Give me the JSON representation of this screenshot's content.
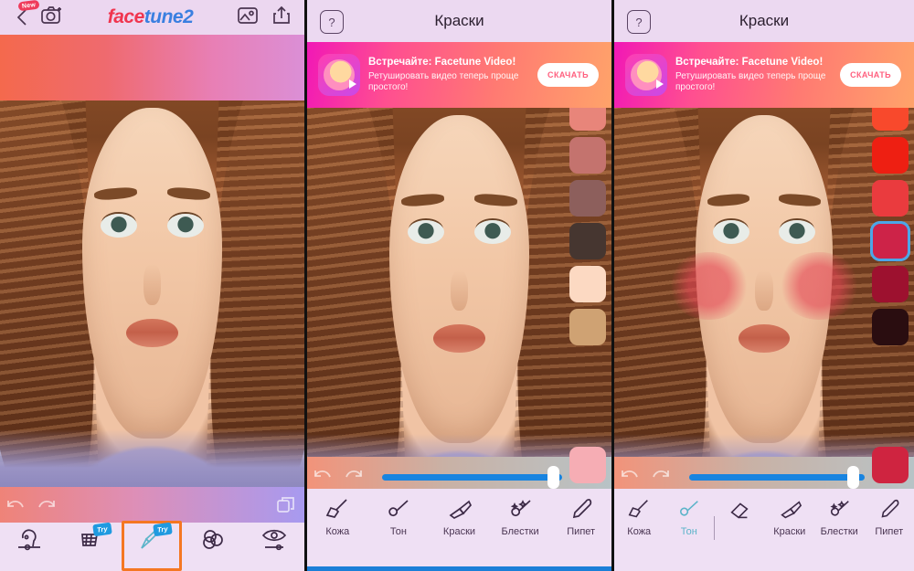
{
  "app": {
    "logo_face": "face",
    "logo_tune": "tune2",
    "new_badge": "New"
  },
  "panel1": {
    "icons": {
      "back": "back-chevron-icon",
      "camera": "camera-icon",
      "gallery": "gallery-icon",
      "share": "share-icon",
      "undo": "undo-icon",
      "redo": "redo-icon",
      "compare": "compare-icon"
    },
    "tools": [
      {
        "label": "",
        "icon": "face-reshape-icon",
        "badge": "",
        "active": false
      },
      {
        "label": "",
        "icon": "patch-grid-icon",
        "badge": "Try",
        "active": false
      },
      {
        "label": "",
        "icon": "makeup-brush-icon",
        "badge": "Try",
        "active": true
      },
      {
        "label": "",
        "icon": "filters-icon",
        "badge": "",
        "active": false
      },
      {
        "label": "",
        "icon": "eye-icon",
        "badge": "",
        "active": false
      }
    ]
  },
  "panel2": {
    "help_label": "?",
    "title": "Краски",
    "banner": {
      "headline": "Встречайте: Facetune Video!",
      "subtext": "Ретушировать видео теперь проще простого!",
      "button": "СКАЧАТЬ",
      "icon": "facetune-video-app-icon"
    },
    "slider": {
      "value": 95
    },
    "swatches": [
      {
        "color": "#f7b8b6",
        "selected": true
      },
      {
        "color": "#e8857a",
        "selected": false
      },
      {
        "color": "#c4736e",
        "selected": false
      },
      {
        "color": "#8d5f5c",
        "selected": false
      },
      {
        "color": "#463630",
        "selected": false
      },
      {
        "color": "#fcd9c2",
        "selected": false
      },
      {
        "color": "#cfa273",
        "selected": false
      }
    ],
    "swatch_floating": "#f6adb4",
    "tools": [
      {
        "label": "Кожа",
        "icon": "skin-brush-icon",
        "active": false
      },
      {
        "label": "Тон",
        "icon": "tone-brush-icon",
        "active": false
      },
      {
        "label": "Краски",
        "icon": "paint-marker-icon",
        "active": false
      },
      {
        "label": "Блестки",
        "icon": "glitter-brush-icon",
        "active": false
      },
      {
        "label": "Пипет",
        "icon": "eyedropper-icon",
        "active": false
      }
    ]
  },
  "panel3": {
    "help_label": "?",
    "title": "Краски",
    "banner": {
      "headline": "Встречайте: Facetune Video!",
      "subtext": "Ретушировать видео теперь проще простого!",
      "button": "СКАЧАТЬ",
      "icon": "facetune-video-app-icon"
    },
    "slider": {
      "value": 93
    },
    "swatches": [
      {
        "color": "#f4614d",
        "selected": false
      },
      {
        "color": "#f8492c",
        "selected": false
      },
      {
        "color": "#ee1f12",
        "selected": false
      },
      {
        "color": "#ea3b3e",
        "selected": false
      },
      {
        "color": "#cd2348",
        "selected": true
      },
      {
        "color": "#9d112f",
        "selected": false
      },
      {
        "color": "#2a0d10",
        "selected": false
      }
    ],
    "swatch_floating": "#cf2440",
    "tools": [
      {
        "label": "Кожа",
        "icon": "skin-brush-icon",
        "active": false
      },
      {
        "label": "Тон",
        "icon": "tone-brush-icon",
        "active": true
      },
      {
        "label": "",
        "icon": "eraser-icon",
        "active": false
      },
      {
        "label": "Краски",
        "icon": "paint-marker-icon",
        "active": false
      },
      {
        "label": "Блестки",
        "icon": "glitter-brush-icon",
        "active": false
      },
      {
        "label": "Пипет",
        "icon": "eyedropper-icon",
        "active": false
      }
    ]
  },
  "colors": {
    "accent_blue": "#1884e0",
    "selection_orange": "#f57722",
    "swatch_outline": "#4ba6e8",
    "banner_pink": "#ff4f90"
  }
}
